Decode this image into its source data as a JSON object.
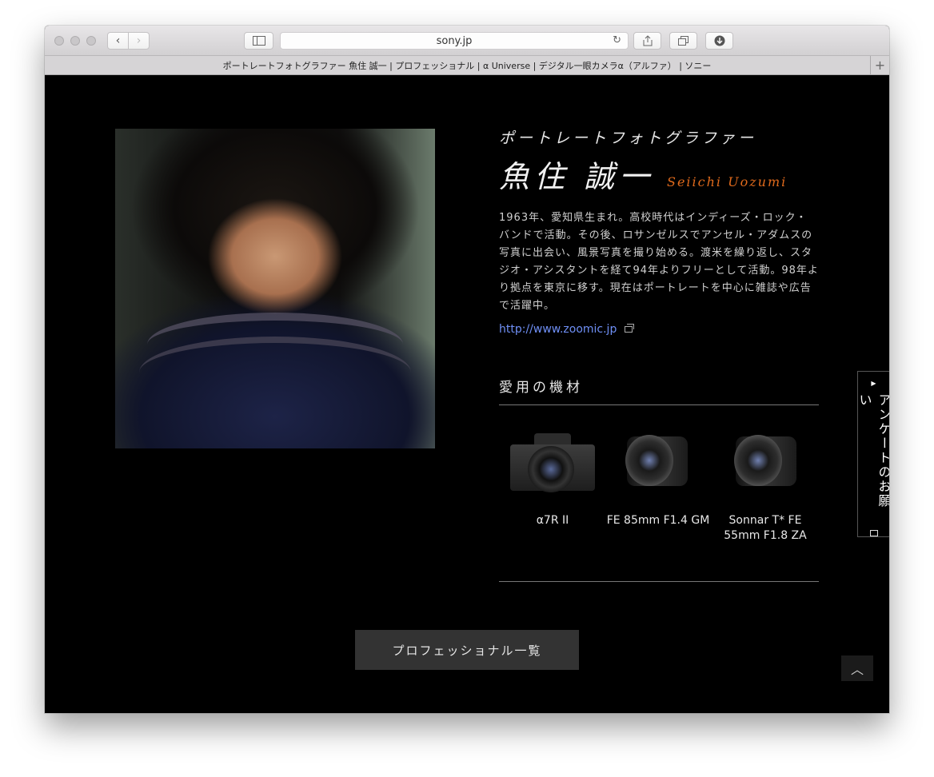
{
  "browser": {
    "url": "sony.jp",
    "tab_title": "ポートレートフォトグラファー 魚住 誠一 | プロフェッショナル | α Universe | デジタル一眼カメラα（アルファ） | ソニー",
    "back_glyph": "‹",
    "forward_glyph": "›",
    "reload_glyph": "↻",
    "new_tab_glyph": "+"
  },
  "profile": {
    "subtitle": "ポートレートフォトグラファー",
    "name_ja": "魚住 誠一",
    "name_en": "Seiichi Uozumi",
    "bio": "1963年、愛知県生まれ。高校時代はインディーズ・ロック・バンドで活動。その後、ロサンゼルスでアンセル・アダムスの写真に出会い、風景写真を撮り始める。渡米を繰り返し、スタジオ・アシスタントを経て94年よりフリーとして活動。98年より拠点を東京に移す。現在はポートレートを中心に雑誌や広告で活躍中。",
    "website": "http://www.zoomic.jp"
  },
  "equipment": {
    "heading": "愛用の機材",
    "items": [
      {
        "name": "α7R II",
        "icon": "camera-body-icon"
      },
      {
        "name": "FE 85mm F1.4 GM",
        "icon": "lens-icon"
      },
      {
        "name": "Sonnar T* FE 55mm F1.8 ZA",
        "icon": "lens-icon"
      }
    ]
  },
  "survey": {
    "label": "アンケートのお願い"
  },
  "buttons": {
    "professional_list": "プロフェッショナル一覧",
    "to_top": "︿"
  },
  "colors": {
    "background": "#000000",
    "name_en": "#e06a1c",
    "link": "#6f8ff5",
    "button": "#333333"
  }
}
